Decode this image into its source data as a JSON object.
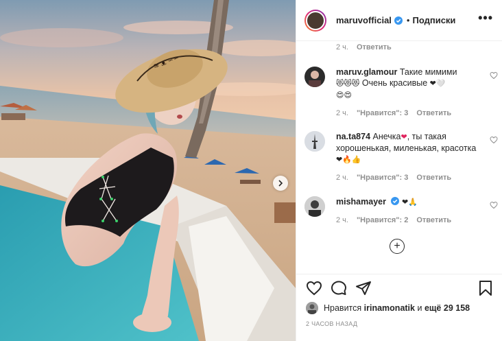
{
  "post": {
    "username": "maruvofficial",
    "separator": "•",
    "follow_label": "Подписки",
    "more_label": "•••"
  },
  "comments": [
    {
      "time": "2 ч.",
      "reply": "Ответить"
    },
    {
      "username": "maruv.glamour",
      "text": "Такие мимими",
      "text2": "Очень красивые",
      "emoji_line1": "😻😻😻",
      "emoji_after": "❤🤍",
      "emoji_line3": "😍😍",
      "time": "2 ч.",
      "likes": "\"Нравится\": 3",
      "reply": "Ответить"
    },
    {
      "username": "na.ta874",
      "text": "Анечка",
      "text_b": ", ты такая хорошенькая, миленькая, красотка",
      "emoji_heart": "❤",
      "emoji_end": "❤🔥👍",
      "time": "2 ч.",
      "likes": "\"Нравится\": 3",
      "reply": "Ответить"
    },
    {
      "username": "mishamayer",
      "emoji": "❤🙏",
      "time": "2 ч.",
      "likes": "\"Нравится\": 2",
      "reply": "Ответить"
    }
  ],
  "load_more": "+",
  "footer": {
    "likes_prefix": "Нравится",
    "likes_user": "irinamonatik",
    "likes_suffix": "и",
    "likes_more": "ещё 29 158",
    "time_ago": "2 ЧАСОВ НАЗАД"
  },
  "icons": [
    "heart-icon",
    "comment-icon",
    "share-icon",
    "bookmark-icon",
    "verified-icon",
    "add-comment-icon",
    "chevron-right-icon"
  ],
  "colors": {
    "verified": "#3897f0",
    "muted": "#8e8e8e",
    "text": "#262626",
    "border": "#efefef"
  }
}
